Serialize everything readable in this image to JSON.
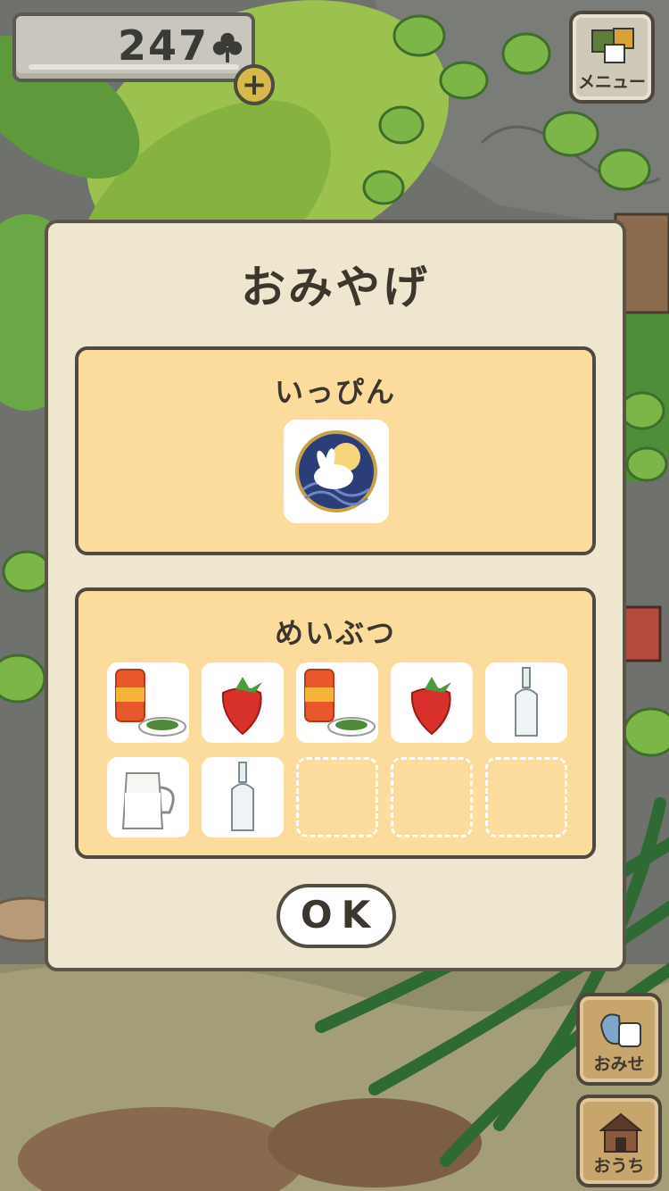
{
  "hud": {
    "clover_count": "247",
    "add_button": "+"
  },
  "menu": {
    "label": "メニュー"
  },
  "side": {
    "shop_label": "おみせ",
    "home_label": "おうち"
  },
  "dialog": {
    "title": "おみやげ",
    "specialty": {
      "title": "いっぴん",
      "item_icon": "rabbit-moon-badge"
    },
    "local_goods": {
      "title": "めいぶつ",
      "items": [
        {
          "icon": "canned-food-with-greens"
        },
        {
          "icon": "strawberry"
        },
        {
          "icon": "canned-food-with-greens"
        },
        {
          "icon": "strawberry"
        },
        {
          "icon": "glass-bottle"
        },
        {
          "icon": "milk-jug"
        },
        {
          "icon": "glass-bottle"
        }
      ],
      "total_slots": 10
    },
    "ok_label": "OK"
  }
}
